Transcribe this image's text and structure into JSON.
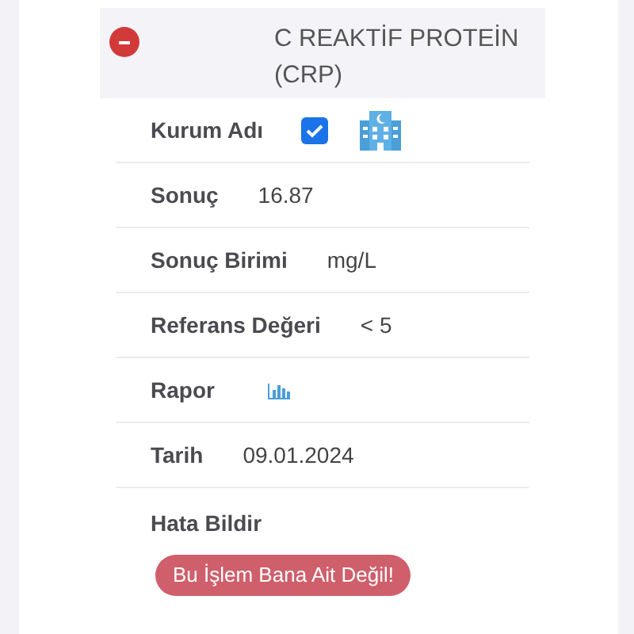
{
  "section": {
    "title": "C REAKTİF PROTEİN (CRP)",
    "expanded": true
  },
  "fields": [
    {
      "kind": "institution",
      "label": "Kurum Adı",
      "checked": true
    },
    {
      "kind": "text",
      "label": "Sonuç",
      "value": "16.87"
    },
    {
      "kind": "text",
      "label": "Sonuç Birimi",
      "value": "mg/L"
    },
    {
      "kind": "text",
      "label": "Referans Değeri",
      "value": "< 5"
    },
    {
      "kind": "report",
      "label": "Rapor"
    },
    {
      "kind": "text",
      "label": "Tarih",
      "value": "09.01.2024"
    }
  ],
  "report_error": {
    "label": "Hata Bildir",
    "button": "Bu İşlem Bana Ait Değil!"
  }
}
